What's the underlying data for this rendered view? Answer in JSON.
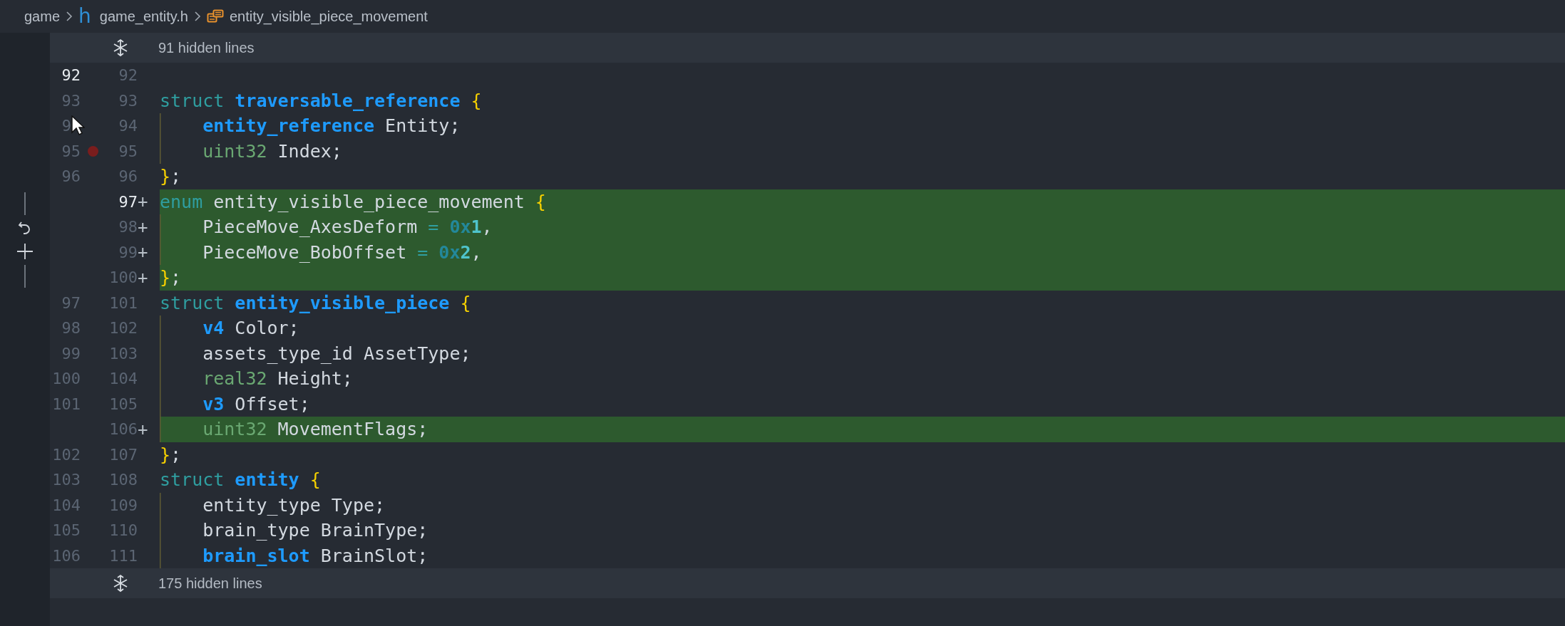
{
  "breadcrumb": [
    {
      "kind": "folder",
      "label": "game"
    },
    {
      "kind": "file",
      "icon": "h",
      "label": "game_entity.h"
    },
    {
      "kind": "symbol",
      "label": "entity_visible_piece_movement"
    }
  ],
  "diff": [
    {
      "kind": "fold",
      "label": "91 hidden lines"
    },
    {
      "kind": "line",
      "old": "92",
      "new": "92",
      "added": false,
      "breakpoint": false,
      "old_active": true,
      "new_active": false,
      "pointer": false,
      "hunk_actions": false
    },
    {
      "kind": "line",
      "old": "93",
      "new": "93",
      "added": false,
      "breakpoint": false,
      "old_active": false,
      "new_active": false,
      "pointer": false,
      "hunk_actions": false,
      "tokens": [
        {
          "text": "struct ",
          "kind": "keyword"
        },
        {
          "text": "traversable_reference",
          "kind": "type"
        },
        {
          "text": " {",
          "kind": "brace"
        }
      ]
    },
    {
      "kind": "line",
      "old": "9",
      "new": "94",
      "added": false,
      "breakpoint": false,
      "old_active": false,
      "new_active": false,
      "pointer": true,
      "hunk_actions": false,
      "tokens": [
        {
          "text": "    entity_reference",
          "kind": "type"
        },
        {
          "text": " Entity;",
          "kind": "plain"
        }
      ]
    },
    {
      "kind": "line",
      "old": "95",
      "new": "95",
      "added": false,
      "breakpoint": true,
      "old_active": false,
      "new_active": false,
      "pointer": false,
      "hunk_actions": false,
      "tokens": [
        {
          "text": "    uint32",
          "kind": "builtin"
        },
        {
          "text": " Index;",
          "kind": "plain"
        }
      ]
    },
    {
      "kind": "line",
      "old": "96",
      "new": "96",
      "added": false,
      "breakpoint": false,
      "old_active": false,
      "new_active": false,
      "pointer": false,
      "hunk_actions": false,
      "tokens": [
        {
          "text": "}",
          "kind": "brace"
        },
        {
          "text": ";",
          "kind": "plain"
        }
      ]
    },
    {
      "kind": "line",
      "new": "97",
      "marker": "+",
      "added": true,
      "breakpoint": false,
      "old_active": false,
      "new_active": true,
      "pointer": false,
      "hunk_actions": true,
      "tokens": [
        {
          "text": "enum ",
          "kind": "keyword"
        },
        {
          "text": "entity_visible_piece_movement",
          "kind": "plain"
        },
        {
          "text": " {",
          "kind": "brace"
        }
      ]
    },
    {
      "kind": "line",
      "new": "98",
      "marker": "+",
      "added": true,
      "breakpoint": false,
      "old_active": false,
      "new_active": false,
      "pointer": false,
      "hunk_actions": false,
      "tokens": [
        {
          "text": "    PieceMove_AxesDeform ",
          "kind": "plain"
        },
        {
          "text": "=",
          "kind": "operator"
        },
        {
          "text": " 0x",
          "kind": "number-prefix"
        },
        {
          "text": "1",
          "kind": "number"
        },
        {
          "text": ",",
          "kind": "plain"
        }
      ]
    },
    {
      "kind": "line",
      "new": "99",
      "marker": "+",
      "added": true,
      "breakpoint": false,
      "old_active": false,
      "new_active": false,
      "pointer": false,
      "hunk_actions": false,
      "tokens": [
        {
          "text": "    PieceMove_BobOffset ",
          "kind": "plain"
        },
        {
          "text": "=",
          "kind": "operator"
        },
        {
          "text": " 0x",
          "kind": "number-prefix"
        },
        {
          "text": "2",
          "kind": "number"
        },
        {
          "text": ",",
          "kind": "plain"
        }
      ]
    },
    {
      "kind": "line",
      "new": "100",
      "marker": "+",
      "added": true,
      "breakpoint": false,
      "old_active": false,
      "new_active": false,
      "pointer": false,
      "hunk_actions": false,
      "tokens": [
        {
          "text": "}",
          "kind": "brace"
        },
        {
          "text": ";",
          "kind": "plain"
        }
      ]
    },
    {
      "kind": "line",
      "old": "97",
      "new": "101",
      "added": false,
      "breakpoint": false,
      "old_active": false,
      "new_active": false,
      "pointer": false,
      "hunk_actions": false,
      "tokens": [
        {
          "text": "struct ",
          "kind": "keyword"
        },
        {
          "text": "entity_visible_piece",
          "kind": "type"
        },
        {
          "text": " {",
          "kind": "brace"
        }
      ]
    },
    {
      "kind": "line",
      "old": "98",
      "new": "102",
      "added": false,
      "breakpoint": false,
      "old_active": false,
      "new_active": false,
      "pointer": false,
      "hunk_actions": false,
      "tokens": [
        {
          "text": "    v4",
          "kind": "type"
        },
        {
          "text": " Color;",
          "kind": "plain"
        }
      ]
    },
    {
      "kind": "line",
      "old": "99",
      "new": "103",
      "added": false,
      "breakpoint": false,
      "old_active": false,
      "new_active": false,
      "pointer": false,
      "hunk_actions": false,
      "tokens": [
        {
          "text": "    assets_type_id AssetType;",
          "kind": "plain"
        }
      ]
    },
    {
      "kind": "line",
      "old": "100",
      "new": "104",
      "added": false,
      "breakpoint": false,
      "old_active": false,
      "new_active": false,
      "pointer": false,
      "hunk_actions": false,
      "tokens": [
        {
          "text": "    real32",
          "kind": "builtin"
        },
        {
          "text": " Height;",
          "kind": "plain"
        }
      ]
    },
    {
      "kind": "line",
      "old": "101",
      "new": "105",
      "added": false,
      "breakpoint": false,
      "old_active": false,
      "new_active": false,
      "pointer": false,
      "hunk_actions": false,
      "tokens": [
        {
          "text": "    v3",
          "kind": "type"
        },
        {
          "text": " Offset;",
          "kind": "plain"
        }
      ]
    },
    {
      "kind": "line",
      "new": "106",
      "marker": "+",
      "added": true,
      "breakpoint": false,
      "old_active": false,
      "new_active": false,
      "pointer": false,
      "hunk_actions": false,
      "tokens": [
        {
          "text": "    uint32",
          "kind": "builtin"
        },
        {
          "text": " MovementFlags;",
          "kind": "plain"
        }
      ]
    },
    {
      "kind": "line",
      "old": "102",
      "new": "107",
      "added": false,
      "breakpoint": false,
      "old_active": false,
      "new_active": false,
      "pointer": false,
      "hunk_actions": false,
      "tokens": [
        {
          "text": "}",
          "kind": "brace"
        },
        {
          "text": ";",
          "kind": "plain"
        }
      ]
    },
    {
      "kind": "line",
      "old": "103",
      "new": "108",
      "added": false,
      "breakpoint": false,
      "old_active": false,
      "new_active": false,
      "pointer": false,
      "hunk_actions": false,
      "tokens": [
        {
          "text": "struct ",
          "kind": "keyword"
        },
        {
          "text": "entity",
          "kind": "type"
        },
        {
          "text": " {",
          "kind": "brace"
        }
      ]
    },
    {
      "kind": "line",
      "old": "104",
      "new": "109",
      "added": false,
      "breakpoint": false,
      "old_active": false,
      "new_active": false,
      "pointer": false,
      "hunk_actions": false,
      "tokens": [
        {
          "text": "    entity_type Type;",
          "kind": "plain"
        }
      ]
    },
    {
      "kind": "line",
      "old": "105",
      "new": "110",
      "added": false,
      "breakpoint": false,
      "old_active": false,
      "new_active": false,
      "pointer": false,
      "hunk_actions": false,
      "tokens": [
        {
          "text": "    brain_type BrainType;",
          "kind": "plain"
        }
      ]
    },
    {
      "kind": "line",
      "old": "106",
      "new": "111",
      "added": false,
      "breakpoint": false,
      "old_active": false,
      "new_active": false,
      "pointer": false,
      "hunk_actions": false,
      "tokens": [
        {
          "text": "    brain_slot",
          "kind": "type"
        },
        {
          "text": " BrainSlot;",
          "kind": "plain"
        }
      ]
    },
    {
      "kind": "fold",
      "label": "175 hidden lines"
    }
  ]
}
